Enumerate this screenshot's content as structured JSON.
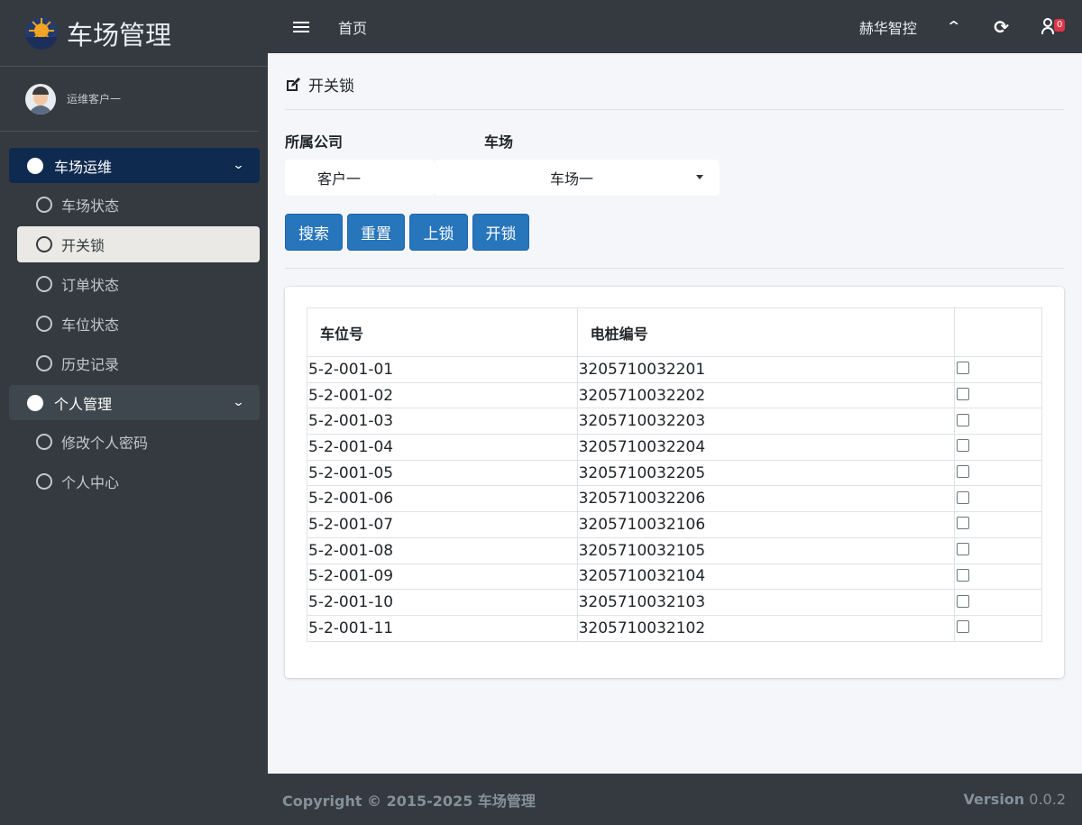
{
  "app": {
    "title": "车场管理"
  },
  "user": {
    "name": "运维客户一"
  },
  "sidebar": {
    "groups": [
      {
        "label": "车场运维",
        "items": [
          "车场状态",
          "开关锁",
          "订单状态",
          "车位状态",
          "历史记录"
        ]
      },
      {
        "label": "个人管理",
        "items": [
          "修改个人密码",
          "个人中心"
        ]
      }
    ]
  },
  "topbar": {
    "home": "首页",
    "company": "赫华智控",
    "badge": "0"
  },
  "page": {
    "title": "开关锁",
    "company_label": "所属公司",
    "company_value": "客户一",
    "lot_label": "车场",
    "lot_value": "车场一",
    "buttons": {
      "search": "搜索",
      "reset": "重置",
      "lock": "上锁",
      "unlock": "开锁"
    }
  },
  "table": {
    "headers": [
      "车位号",
      "电桩编号",
      ""
    ],
    "rows": [
      [
        "5-2-001-01",
        "3205710032201"
      ],
      [
        "5-2-001-02",
        "3205710032202"
      ],
      [
        "5-2-001-03",
        "3205710032203"
      ],
      [
        "5-2-001-04",
        "3205710032204"
      ],
      [
        "5-2-001-05",
        "3205710032205"
      ],
      [
        "5-2-001-06",
        "3205710032206"
      ],
      [
        "5-2-001-07",
        "3205710032106"
      ],
      [
        "5-2-001-08",
        "3205710032105"
      ],
      [
        "5-2-001-09",
        "3205710032104"
      ],
      [
        "5-2-001-10",
        "3205710032103"
      ],
      [
        "5-2-001-11",
        "3205710032102"
      ]
    ]
  },
  "footer": {
    "copyright": "Copyright © 2015-2025 车场管理",
    "version_label": "Version",
    "version": "0.0.2"
  },
  "icons": {
    "brand": "sun-logo-icon",
    "menu": "hamburger-icon",
    "up": "chevron-up-icon",
    "refresh": "refresh-icon",
    "user": "user-icon",
    "edit": "edit-icon"
  },
  "colors": {
    "sidebar": "#343a40",
    "primary": "#2775bb",
    "nav_active": "#0f2a4f",
    "badge": "#dc3545"
  }
}
